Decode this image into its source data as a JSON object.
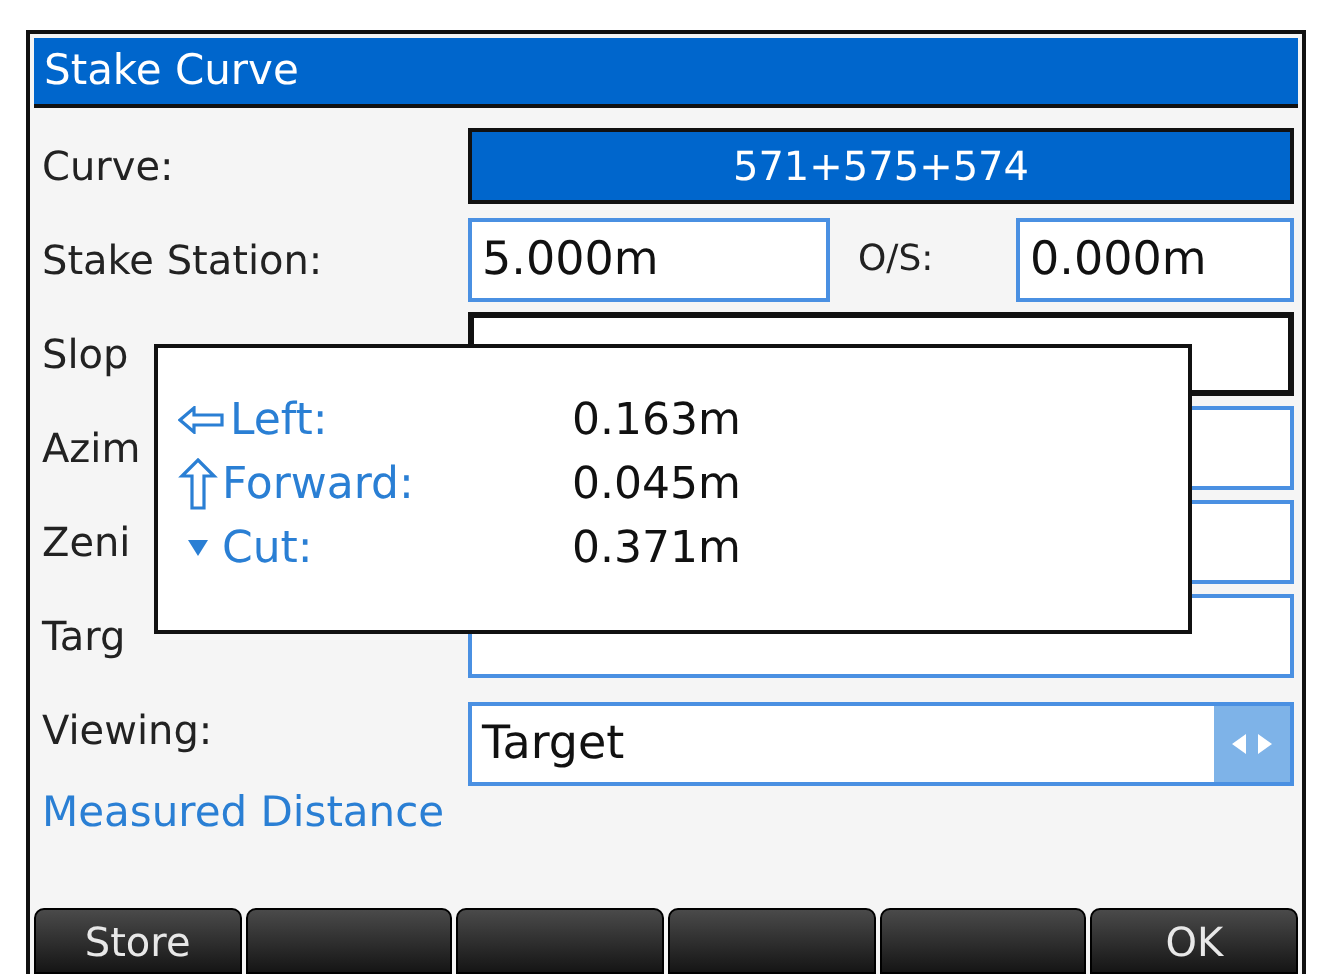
{
  "window": {
    "title": "Stake Curve"
  },
  "rows": [
    {
      "kind": "selector",
      "label": "Curve:",
      "value": "571+575+574"
    },
    {
      "kind": "pair",
      "label": "Stake Station:",
      "value": "5.000m",
      "second_label": "O/S:",
      "second_value": "0.000m"
    },
    {
      "kind": "field",
      "label": "Slop",
      "value": "",
      "focused": true
    },
    {
      "kind": "field",
      "label": "Azim",
      "value": "",
      "focused": false
    },
    {
      "kind": "field",
      "label": "Zeni",
      "value": "",
      "focused": false
    },
    {
      "kind": "field",
      "label": "Targ",
      "value": "",
      "focused": false
    },
    {
      "kind": "choose",
      "label": "Viewing:",
      "value": "Target"
    }
  ],
  "section_label": "Measured Distance",
  "popup": {
    "items": [
      {
        "kind": "left",
        "label": "Left:",
        "value": "0.163m"
      },
      {
        "kind": "forward",
        "label": "Forward:",
        "value": "0.045m"
      },
      {
        "kind": "cut",
        "label": "Cut:",
        "value": "0.371m"
      }
    ]
  },
  "softkeys": [
    {
      "kind": "label",
      "label": "Store"
    },
    {
      "kind": "blank"
    },
    {
      "kind": "blank"
    },
    {
      "kind": "blank"
    },
    {
      "kind": "blank"
    },
    {
      "kind": "label",
      "label": "OK"
    }
  ]
}
